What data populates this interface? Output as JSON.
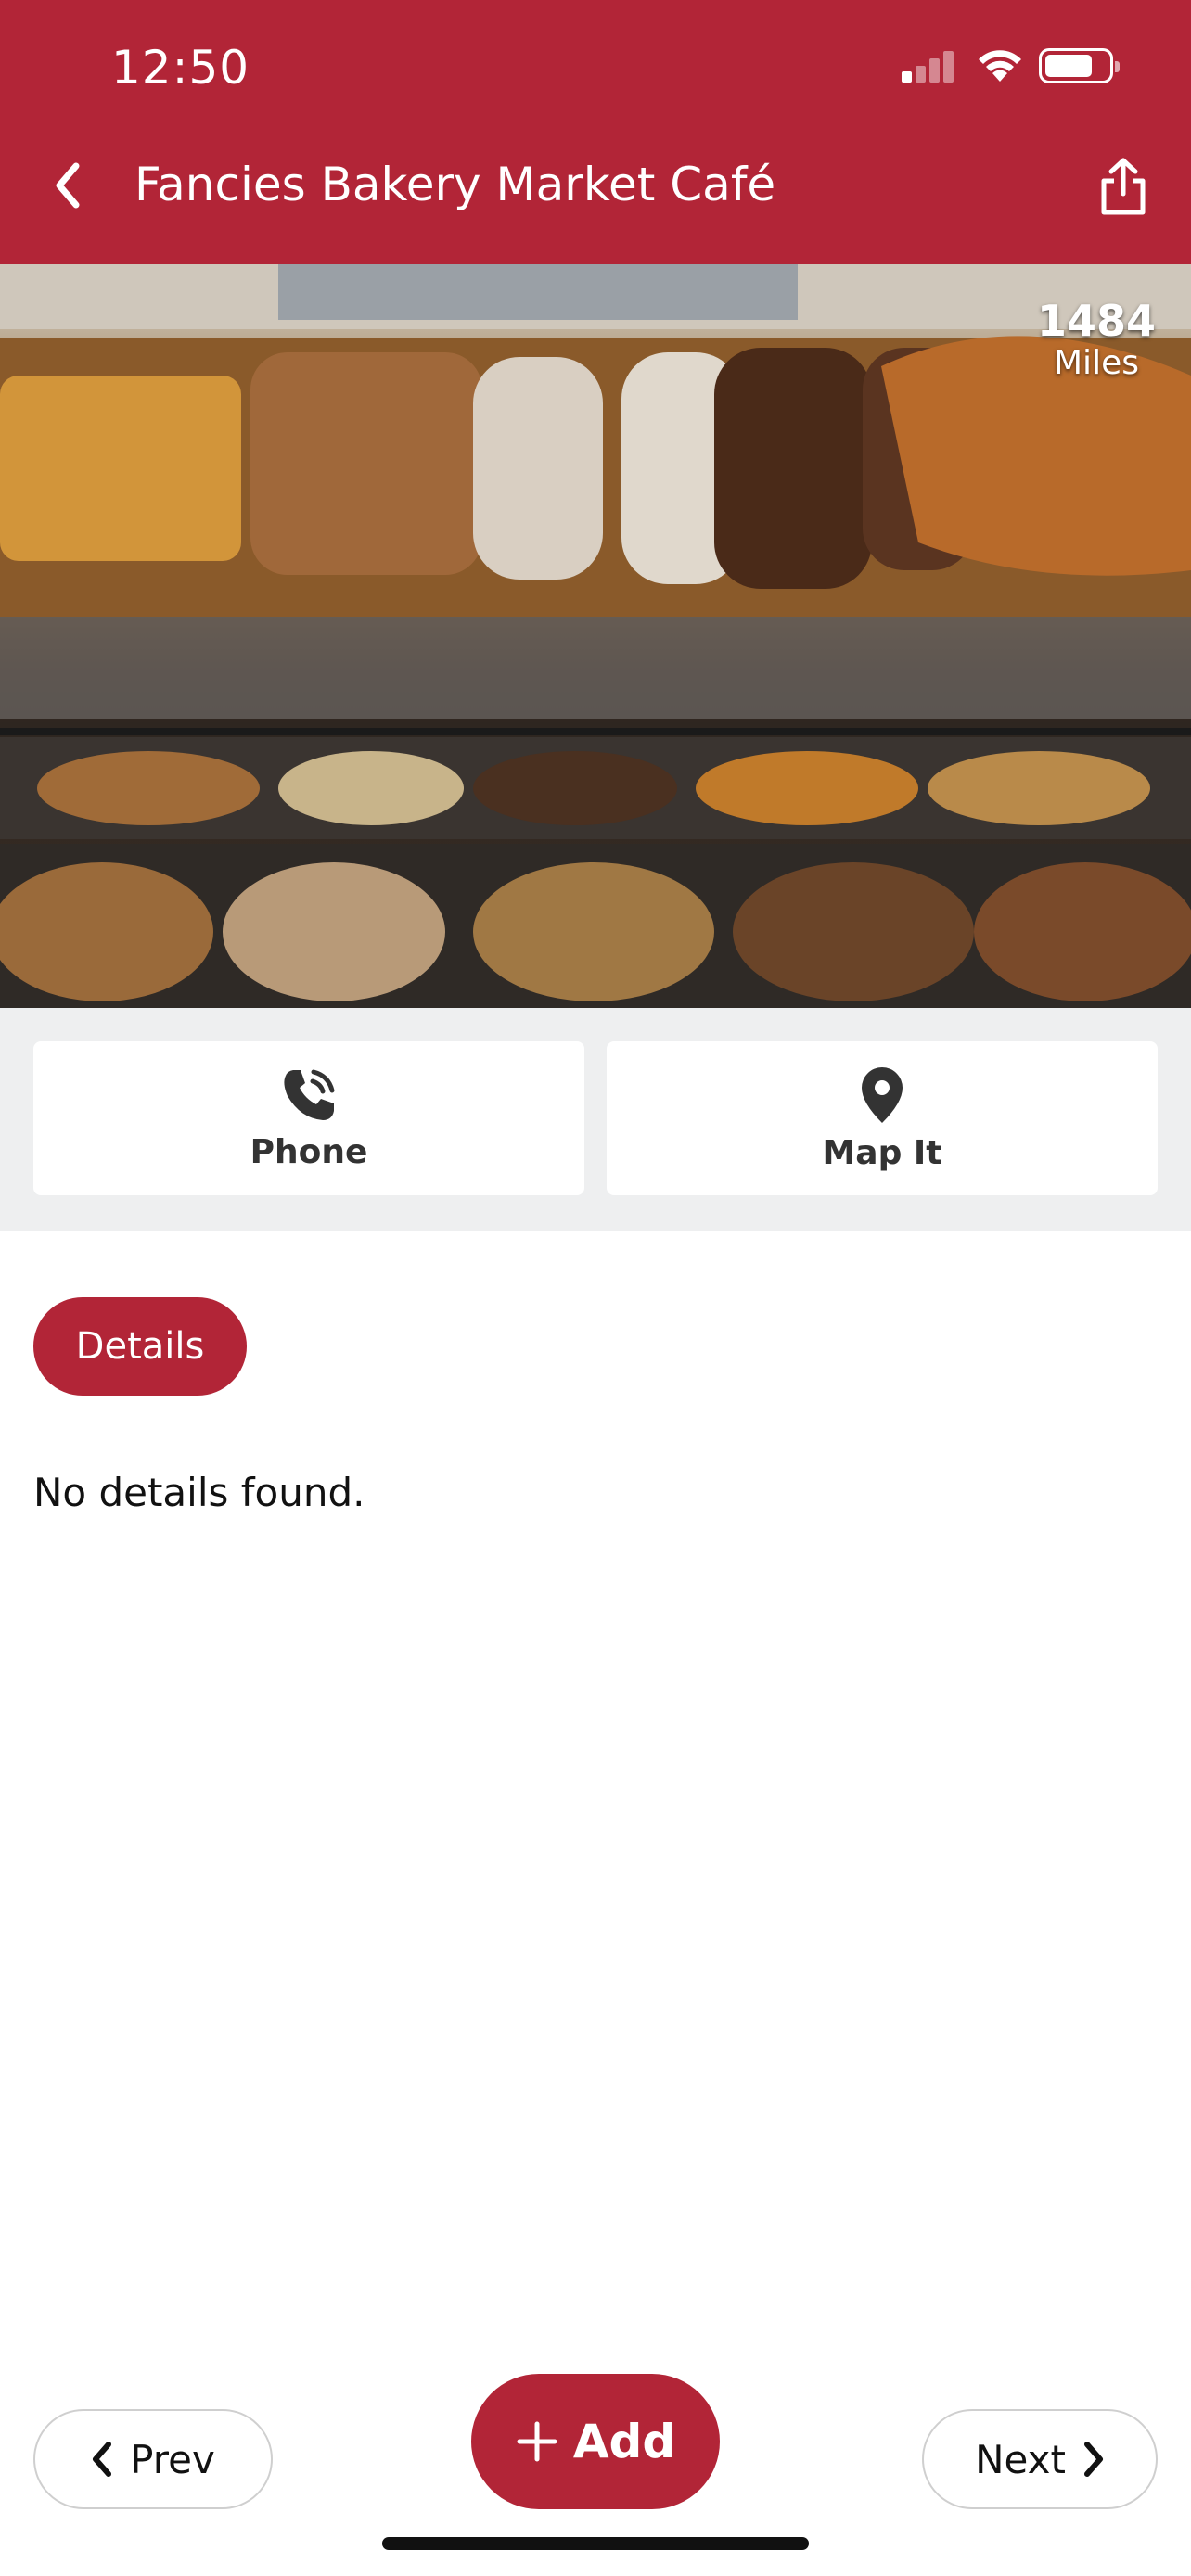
{
  "status_bar": {
    "time": "12:50"
  },
  "header": {
    "title": "Fancies Bakery Market Café",
    "back_icon": "chevron-left-icon",
    "share_icon": "share-icon"
  },
  "hero": {
    "distance_value": "1484",
    "distance_unit": "Miles"
  },
  "actions": [
    {
      "label": "Phone",
      "icon": "phone-icon"
    },
    {
      "label": "Map It",
      "icon": "map-pin-icon"
    }
  ],
  "details": {
    "pill_label": "Details",
    "empty_text": "No details found."
  },
  "footer": {
    "prev_label": "Prev",
    "add_label": "Add",
    "next_label": "Next"
  },
  "colors": {
    "brand": "#b22537",
    "action_bar_bg": "#eeeff0"
  }
}
